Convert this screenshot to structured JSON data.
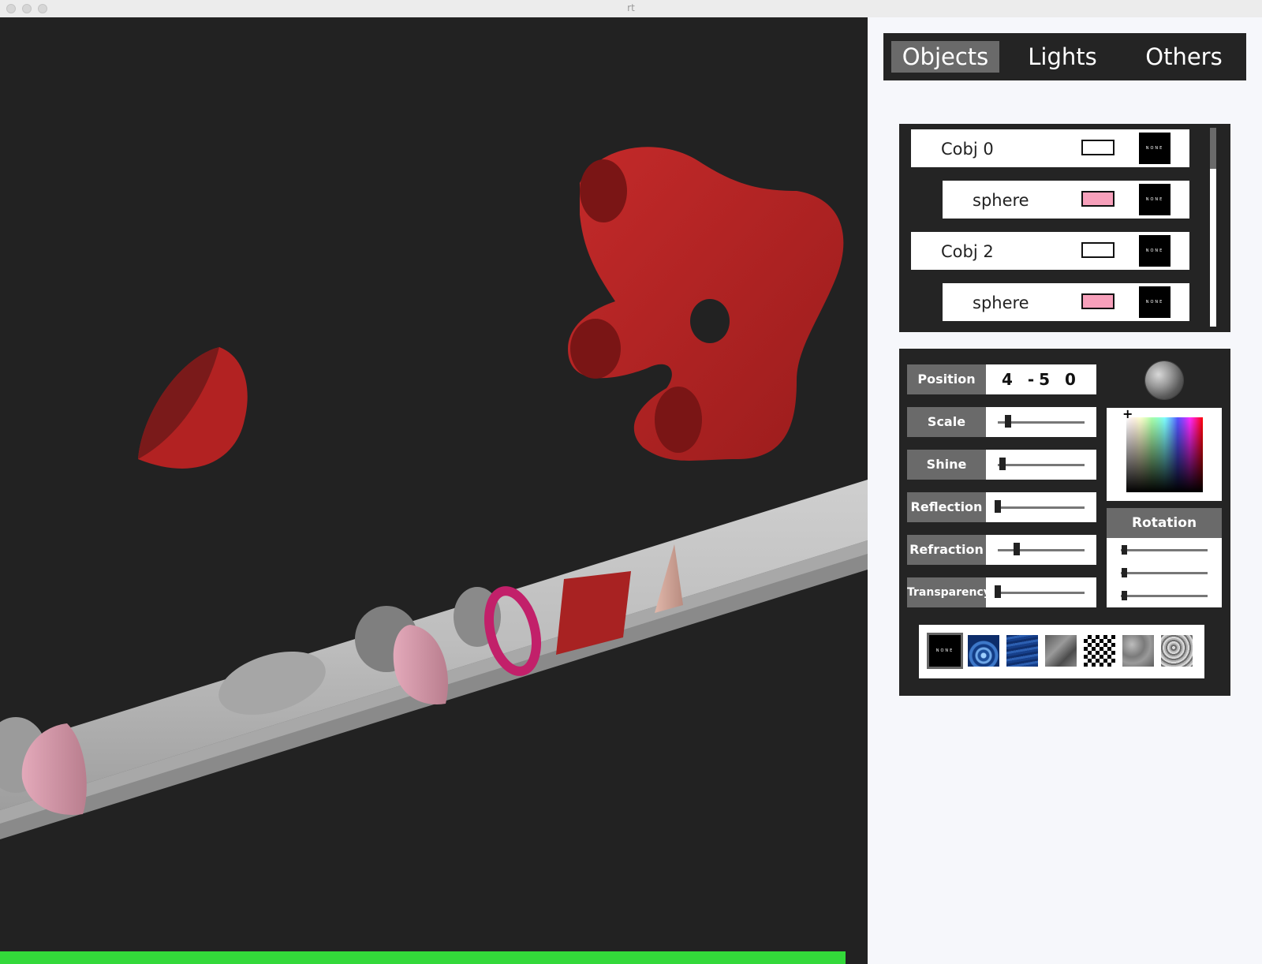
{
  "window": {
    "title": "rt"
  },
  "tabs": [
    {
      "label": "Objects",
      "active": true
    },
    {
      "label": "Lights",
      "active": false
    },
    {
      "label": "Others",
      "active": false
    }
  ],
  "objects": [
    {
      "name": "Cobj 0",
      "color": "#ffffff",
      "texture": "NONE"
    },
    {
      "name": "sphere",
      "color": "#f7a0bb",
      "texture": "NONE"
    },
    {
      "name": "Cobj 2",
      "color": "#ffffff",
      "texture": "NONE"
    },
    {
      "name": "sphere",
      "color": "#f7a0bb",
      "texture": "NONE"
    }
  ],
  "properties": {
    "position": {
      "label": "Position",
      "value": "4 -5 0"
    },
    "sliders": [
      {
        "label": "Scale",
        "level": 0.12
      },
      {
        "label": "Shine",
        "level": 0.05
      },
      {
        "label": "Reflection",
        "level": 0.0
      },
      {
        "label": "Refraction",
        "level": 0.22
      },
      {
        "label": "Transparency",
        "level": 0.0
      }
    ]
  },
  "rotation": {
    "label": "Rotation",
    "levels": [
      0.0,
      0.0,
      0.0
    ]
  },
  "textures": [
    {
      "name": "none",
      "label": "NONE",
      "selected": true
    },
    {
      "name": "water-ripple"
    },
    {
      "name": "blue-waves"
    },
    {
      "name": "metal"
    },
    {
      "name": "checkerboard"
    },
    {
      "name": "cloud-noise"
    },
    {
      "name": "marble-noise"
    }
  ],
  "render_progress": 1.0
}
